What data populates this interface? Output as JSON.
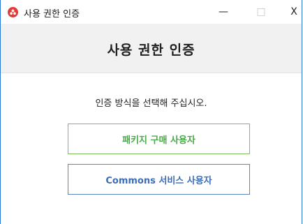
{
  "window": {
    "title": "사용 권한 인증",
    "controls": {
      "minimize": "—",
      "maximize": "□",
      "close": "X"
    },
    "icon": "app-logo-icon"
  },
  "header": {
    "title": "사용 권한 인증"
  },
  "body": {
    "instruction": "인증 방식을 선택해 주십시오.",
    "options": [
      {
        "label": "패키지 구매 사용자",
        "color": "#4aa84a"
      },
      {
        "label": "Commons 서비스 사용자",
        "color": "#3f6db5"
      }
    ]
  }
}
